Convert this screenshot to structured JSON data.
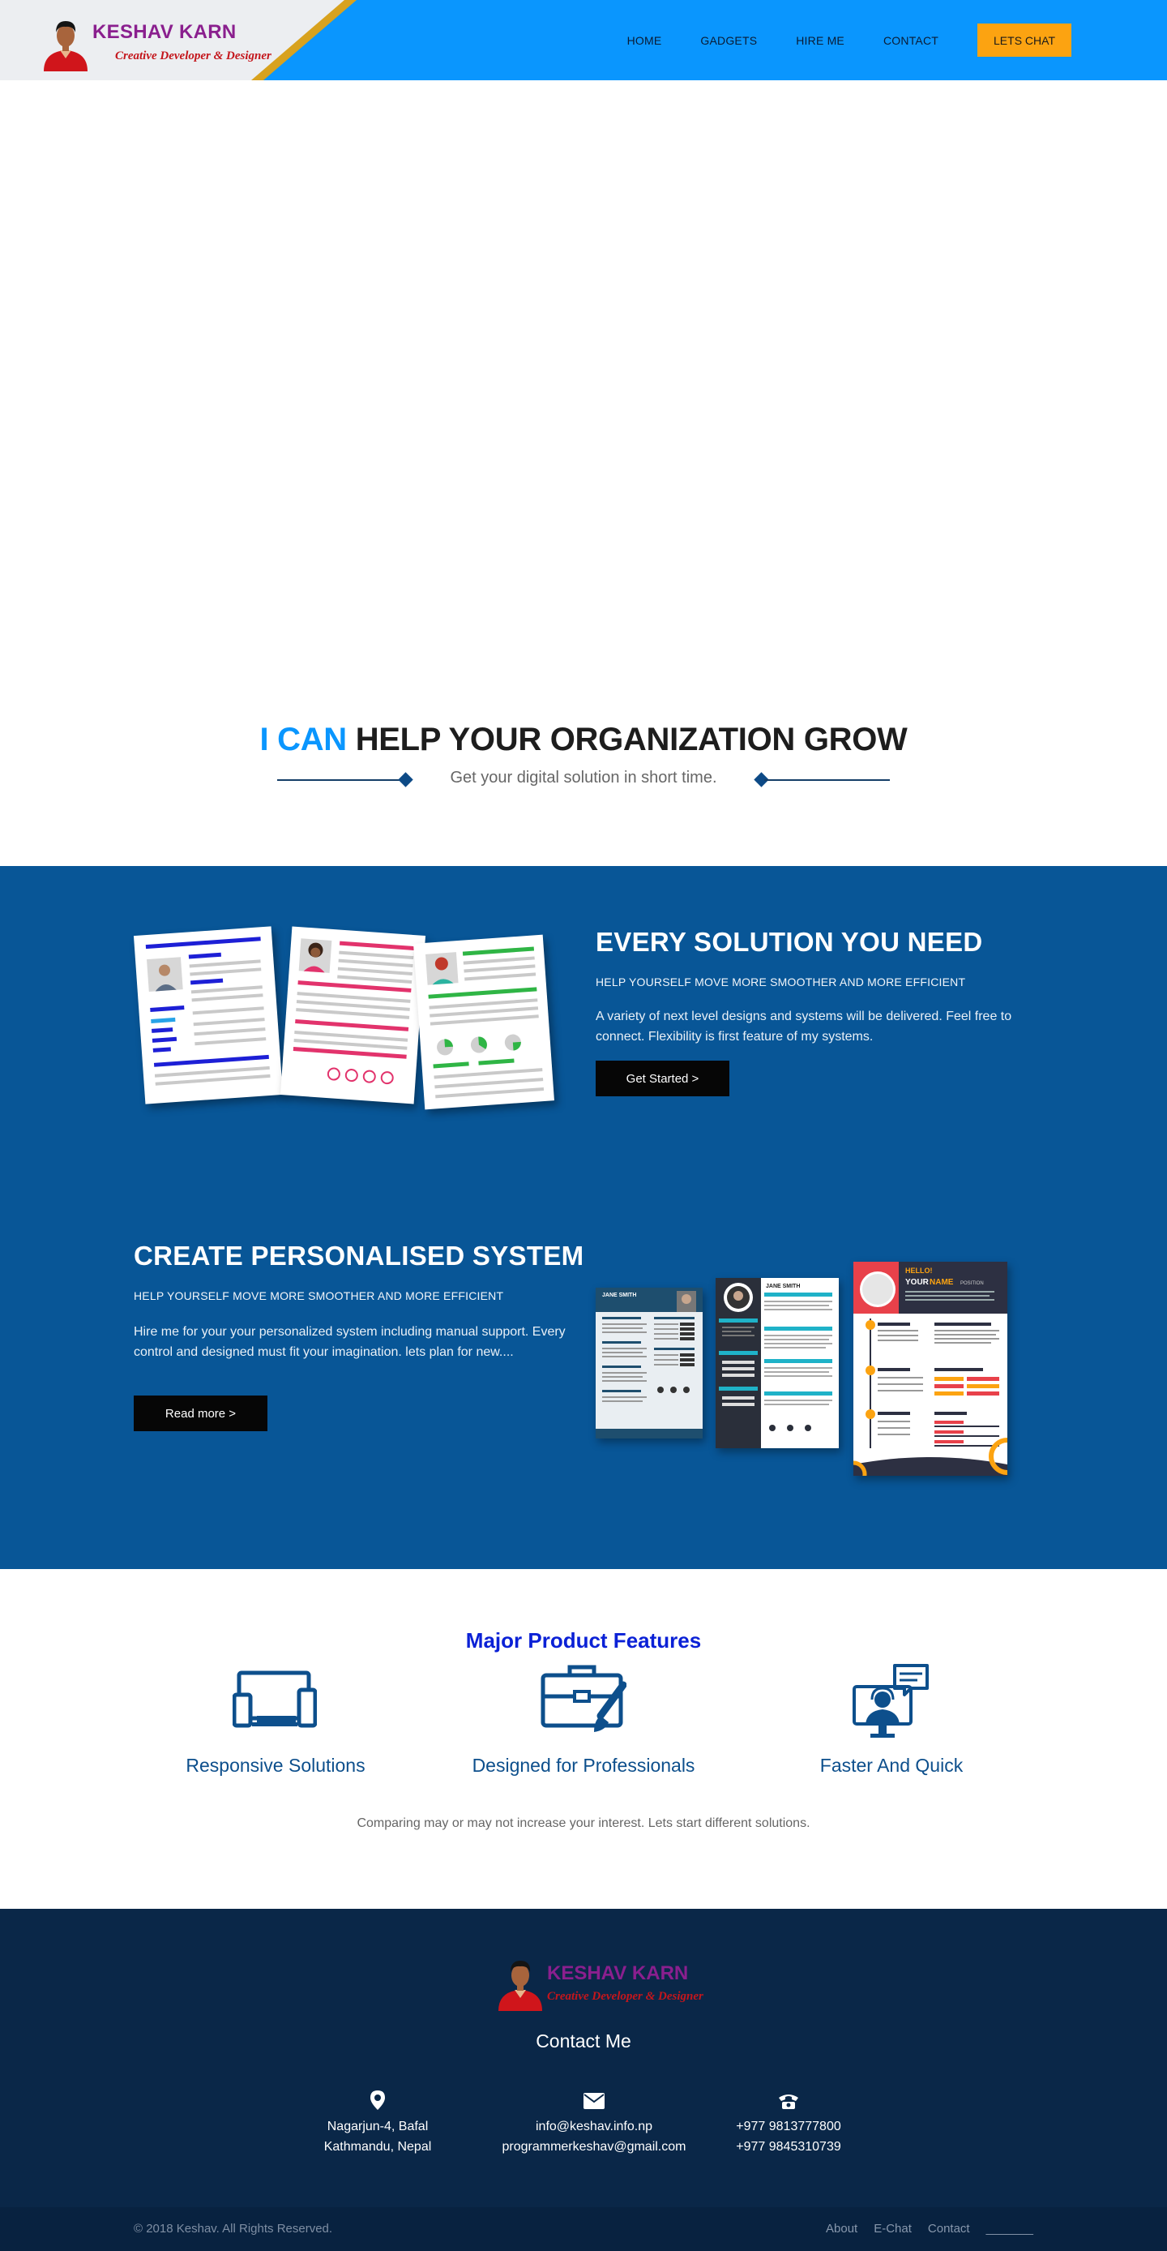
{
  "header": {
    "brand_name": "KESHAV KARN",
    "brand_tagline": "Creative Developer & Designer",
    "nav": [
      "HOME",
      "GADGETS",
      "HIRE ME",
      "CONTACT"
    ],
    "cta": "LETS CHAT"
  },
  "intro": {
    "title_accent": "I CAN",
    "title_rest": " HELP YOUR ORGANIZATION GROW",
    "subtitle": "Get your digital solution in short time."
  },
  "solutions": [
    {
      "title": "EVERY SOLUTION YOU NEED",
      "subtitle": "HELP YOURSELF MOVE MORE SMOOTHER AND MORE EFFICIENT",
      "body": "A variety of next level designs and systems will be delivered. Feel free to connect. Flexibility is first feature of my systems.",
      "button": "Get Started >"
    },
    {
      "title": "CREATE PERSONALISED SYSTEM",
      "subtitle": "HELP YOURSELF MOVE MORE SMOOTHER AND MORE EFFICIENT",
      "body": "Hire me for your your personalized system including manual support. Every control and designed must fit your imagination. lets plan for new....",
      "button": "Read more >"
    }
  ],
  "resumes": {
    "name1": "JANE SMITH",
    "name2": "JANE SMITH",
    "hello": "HELLO!",
    "your": "YOUR",
    "name_word": "NAME",
    "position": "POSITION"
  },
  "features": {
    "title": "Major Product Features",
    "items": [
      {
        "label": "Responsive Solutions",
        "icon": "devices-icon"
      },
      {
        "label": "Designed for Professionals",
        "icon": "briefcase-brush-icon"
      },
      {
        "label": "Faster And Quick",
        "icon": "support-chat-icon"
      }
    ],
    "note": "Comparing may or may not increase your interest. Lets start different solutions."
  },
  "footer": {
    "brand_name": "KESHAV KARN",
    "brand_tagline": "Creative Developer & Designer",
    "contact_title": "Contact Me",
    "address": [
      "Nagarjun-4, Bafal",
      "Kathmandu, Nepal"
    ],
    "email": [
      "info@keshav.info.np",
      "programmerkeshav@gmail.com"
    ],
    "phone": [
      "+977 9813777800",
      "+977 9845310739"
    ],
    "copyright": "© 2018 Keshav. All Rights Reserved.",
    "links": [
      "About",
      "E-Chat",
      "Contact",
      "_______"
    ]
  },
  "colors": {
    "header_blue": "#0a96fe",
    "accent_gold": "#fca311",
    "section_blue": "#085697",
    "footer_navy": "#0a2748",
    "feature_blue": "#0d4f8c"
  }
}
